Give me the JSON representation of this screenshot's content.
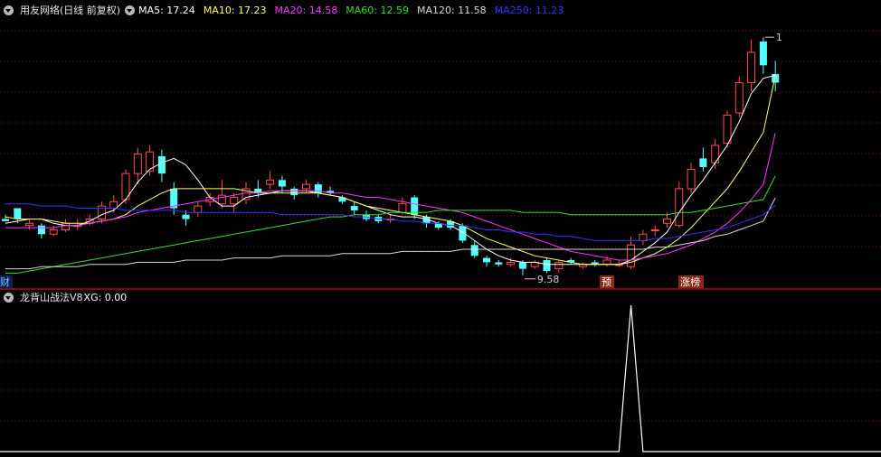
{
  "top_legend": {
    "title": "用友网络(日线 前复权)",
    "items": [
      {
        "label": "MA5: 17.24",
        "color": "#ffffff"
      },
      {
        "label": "MA10: 17.23",
        "color": "#ffff66"
      },
      {
        "label": "MA20: 14.58",
        "color": "#ff33ff"
      },
      {
        "label": "MA60: 12.59",
        "color": "#33dd33"
      },
      {
        "label": "MA120: 11.58",
        "color": "#d8d8d8"
      },
      {
        "label": "MA250: 11.23",
        "color": "#3333ff"
      }
    ]
  },
  "bottom_legend": {
    "title": "龙背山战法V8",
    "items": [
      {
        "label": "XG: 0.00",
        "color": "#ffffff"
      }
    ]
  },
  "markers": [
    {
      "label": "财",
      "index": 0,
      "bg": "#0b1f55",
      "fg": "#66ccff"
    },
    {
      "label": "预",
      "index": 50,
      "bg": "#8a2a1a",
      "fg": "#ffffff"
    },
    {
      "label": "涨榜",
      "index": 57,
      "bg": "#8a2a1a",
      "fg": "#ffffff"
    }
  ],
  "annotations": {
    "low_label": "9.58",
    "high_label": "1"
  },
  "colors": {
    "up": "#ff4c4c",
    "down": "#54ffff",
    "grid": "#7a1010",
    "separator": "#aa1414",
    "indicator": "#ffffff"
  },
  "chart_data": [
    {
      "type": "candlestick",
      "title": "用友网络(日线 前复权)",
      "ylim": [
        8.2,
        19.8
      ],
      "candles": [
        [
          10.6,
          10.5,
          10.8,
          10.6
        ],
        [
          11.1,
          10.6,
          10.8,
          10.4
        ],
        [
          10.3,
          10.4,
          10.6,
          10.1
        ],
        [
          10.3,
          9.9,
          10.4,
          9.7
        ],
        [
          9.9,
          10.1,
          10.3,
          9.8
        ],
        [
          10.1,
          10.4,
          10.6,
          10.0
        ],
        [
          10.3,
          10.3,
          10.6,
          10.1
        ],
        [
          10.4,
          10.6,
          10.8,
          10.3
        ],
        [
          10.6,
          11.2,
          11.4,
          10.4
        ],
        [
          11.1,
          11.4,
          11.7,
          10.9
        ],
        [
          11.5,
          12.7,
          12.9,
          11.3
        ],
        [
          12.7,
          13.6,
          13.9,
          12.2
        ],
        [
          12.8,
          13.7,
          14.0,
          12.6
        ],
        [
          13.5,
          12.7,
          13.8,
          12.3
        ],
        [
          12.0,
          11.1,
          12.3,
          10.8
        ],
        [
          10.8,
          10.6,
          11.0,
          10.3
        ],
        [
          10.9,
          11.2,
          11.4,
          10.7
        ],
        [
          11.4,
          11.6,
          11.8,
          11.2
        ],
        [
          11.3,
          11.7,
          12.4,
          11.1
        ],
        [
          11.3,
          11.6,
          11.8,
          10.9
        ],
        [
          11.5,
          12.0,
          12.3,
          11.3
        ],
        [
          12.0,
          11.8,
          12.4,
          11.6
        ],
        [
          12.2,
          12.4,
          12.8,
          12.0
        ],
        [
          12.4,
          12.1,
          12.6,
          11.8
        ],
        [
          12.0,
          11.7,
          12.1,
          11.5
        ],
        [
          12.0,
          12.2,
          12.4,
          11.8
        ],
        [
          12.2,
          11.8,
          12.3,
          11.6
        ],
        [
          11.9,
          11.8,
          12.1,
          11.7
        ],
        [
          11.6,
          11.4,
          11.7,
          11.3
        ],
        [
          11.2,
          11.0,
          11.4,
          10.8
        ],
        [
          10.8,
          10.6,
          11.0,
          10.5
        ],
        [
          10.7,
          10.5,
          10.8,
          10.4
        ],
        [
          10.6,
          10.6,
          10.8,
          10.4
        ],
        [
          10.9,
          11.3,
          11.6,
          10.8
        ],
        [
          11.6,
          10.8,
          11.7,
          10.6
        ],
        [
          10.7,
          10.4,
          10.8,
          10.2
        ],
        [
          10.4,
          10.2,
          10.5,
          10.1
        ],
        [
          10.5,
          10.2,
          10.6,
          10.1
        ],
        [
          10.3,
          9.6,
          10.4,
          9.5
        ],
        [
          9.4,
          8.9,
          9.6,
          8.8
        ],
        [
          8.8,
          8.6,
          8.9,
          8.4
        ],
        [
          8.6,
          8.5,
          8.7,
          8.4
        ],
        [
          8.5,
          8.6,
          8.8,
          8.4
        ],
        [
          8.6,
          8.3,
          8.7,
          8.0
        ],
        [
          8.4,
          8.6,
          8.7,
          8.3
        ],
        [
          8.7,
          8.2,
          8.8,
          8.1
        ],
        [
          8.3,
          8.6,
          8.7,
          8.1
        ],
        [
          8.7,
          8.6,
          8.8,
          8.5
        ],
        [
          8.4,
          8.5,
          8.6,
          8.3
        ],
        [
          8.6,
          8.5,
          8.7,
          8.4
        ],
        [
          8.5,
          8.7,
          8.9,
          8.4
        ],
        [
          8.5,
          8.5,
          8.7,
          8.4
        ],
        [
          8.4,
          9.4,
          9.8,
          8.3
        ],
        [
          9.6,
          9.9,
          10.1,
          9.4
        ],
        [
          10.1,
          10.1,
          10.3,
          9.8
        ],
        [
          10.4,
          10.6,
          10.9,
          10.2
        ],
        [
          10.3,
          12.0,
          12.3,
          10.2
        ],
        [
          12.0,
          12.9,
          13.2,
          11.8
        ],
        [
          13.4,
          13.0,
          13.9,
          12.8
        ],
        [
          13.2,
          14.0,
          14.3,
          12.9
        ],
        [
          14.1,
          15.4,
          15.6,
          13.9
        ],
        [
          15.5,
          16.9,
          17.2,
          15.3
        ],
        [
          16.9,
          18.3,
          18.9,
          16.5
        ],
        [
          18.8,
          17.7,
          19.0,
          17.3
        ],
        [
          17.3,
          16.9,
          17.9,
          16.5
        ]
      ],
      "series": [
        {
          "name": "MA5",
          "color": "#ffffff",
          "values": [
            10.4,
            10.5,
            10.6,
            10.6,
            10.4,
            10.3,
            10.3,
            10.5,
            10.8,
            11.0,
            11.5,
            12.3,
            12.9,
            13.2,
            13.4,
            13.1,
            12.4,
            11.6,
            11.2,
            11.2,
            11.6,
            11.7,
            11.8,
            11.9,
            11.9,
            11.9,
            11.8,
            11.7,
            11.6,
            11.4,
            11.2,
            11.0,
            10.8,
            10.7,
            10.7,
            10.6,
            10.4,
            10.3,
            10.0,
            9.6,
            9.2,
            8.9,
            8.7,
            8.6,
            8.6,
            8.5,
            8.5,
            8.5,
            8.5,
            8.5,
            8.5,
            8.5,
            8.7,
            9.1,
            9.5,
            10.0,
            10.9,
            11.7,
            12.4,
            13.2,
            14.0,
            15.1,
            16.4,
            17.1,
            17.24
          ]
        },
        {
          "name": "MA10",
          "color": "#ffff66",
          "values": [
            10.7,
            10.6,
            10.6,
            10.6,
            10.5,
            10.4,
            10.4,
            10.4,
            10.5,
            10.6,
            10.8,
            11.2,
            11.5,
            11.8,
            12.0,
            12.0,
            12.0,
            12.0,
            12.0,
            12.0,
            11.9,
            11.8,
            11.8,
            11.8,
            11.8,
            11.8,
            11.8,
            11.7,
            11.6,
            11.4,
            11.2,
            11.1,
            11.0,
            10.9,
            10.8,
            10.7,
            10.6,
            10.5,
            10.3,
            10.0,
            9.7,
            9.5,
            9.3,
            9.1,
            8.9,
            8.8,
            8.7,
            8.6,
            8.5,
            8.5,
            8.5,
            8.5,
            8.6,
            8.8,
            9.0,
            9.3,
            9.7,
            10.2,
            10.8,
            11.4,
            12.0,
            12.8,
            13.7,
            14.6,
            17.23
          ]
        },
        {
          "name": "MA20",
          "color": "#ff33ff",
          "values": [
            10.2,
            10.2,
            10.2,
            10.2,
            10.2,
            10.3,
            10.3,
            10.4,
            10.5,
            10.6,
            10.7,
            10.9,
            11.0,
            11.1,
            11.2,
            11.3,
            11.4,
            11.5,
            11.6,
            11.7,
            11.8,
            11.8,
            11.9,
            11.9,
            11.9,
            11.9,
            11.9,
            11.8,
            11.8,
            11.7,
            11.6,
            11.6,
            11.5,
            11.4,
            11.3,
            11.2,
            11.1,
            11.0,
            10.9,
            10.7,
            10.5,
            10.3,
            10.1,
            9.9,
            9.7,
            9.5,
            9.3,
            9.1,
            9.0,
            8.9,
            8.8,
            8.7,
            8.7,
            8.8,
            8.9,
            9.0,
            9.2,
            9.4,
            9.7,
            10.0,
            10.4,
            10.9,
            11.5,
            12.2,
            14.58
          ]
        },
        {
          "name": "MA60",
          "color": "#33dd33",
          "values": [
            8.1,
            8.1,
            8.2,
            8.3,
            8.4,
            8.5,
            8.6,
            8.7,
            8.8,
            8.9,
            9.0,
            9.1,
            9.2,
            9.3,
            9.4,
            9.5,
            9.6,
            9.7,
            9.8,
            9.9,
            10.0,
            10.1,
            10.2,
            10.3,
            10.4,
            10.5,
            10.6,
            10.7,
            10.7,
            10.8,
            10.8,
            10.8,
            10.9,
            10.9,
            10.9,
            10.9,
            11.0,
            11.0,
            11.0,
            11.0,
            11.0,
            11.0,
            11.0,
            10.9,
            10.9,
            10.9,
            10.9,
            10.8,
            10.8,
            10.8,
            10.8,
            10.8,
            10.8,
            10.8,
            10.8,
            10.8,
            10.9,
            10.9,
            11.0,
            11.1,
            11.2,
            11.3,
            11.4,
            11.5,
            12.59
          ]
        },
        {
          "name": "MA120",
          "color": "#d8d8d8",
          "values": [
            8.3,
            8.3,
            8.3,
            8.4,
            8.4,
            8.4,
            8.4,
            8.5,
            8.5,
            8.5,
            8.5,
            8.6,
            8.6,
            8.6,
            8.6,
            8.7,
            8.7,
            8.7,
            8.7,
            8.8,
            8.8,
            8.8,
            8.8,
            8.9,
            8.9,
            8.9,
            8.9,
            8.9,
            9.0,
            9.0,
            9.0,
            9.0,
            9.0,
            9.1,
            9.1,
            9.1,
            9.1,
            9.1,
            9.2,
            9.2,
            9.2,
            9.2,
            9.2,
            9.2,
            9.2,
            9.2,
            9.2,
            9.2,
            9.2,
            9.2,
            9.2,
            9.2,
            9.2,
            9.2,
            9.3,
            9.3,
            9.4,
            9.5,
            9.6,
            9.8,
            9.9,
            10.1,
            10.3,
            10.5,
            11.58
          ]
        },
        {
          "name": "MA250",
          "color": "#3333ff",
          "values": [
            11.3,
            11.3,
            11.3,
            11.2,
            11.2,
            11.2,
            11.1,
            11.1,
            11.1,
            11.1,
            11.0,
            11.0,
            11.0,
            11.0,
            11.0,
            10.9,
            10.9,
            10.9,
            10.9,
            10.9,
            10.9,
            10.9,
            10.9,
            10.8,
            10.8,
            10.8,
            10.8,
            10.8,
            10.8,
            10.7,
            10.7,
            10.6,
            10.6,
            10.5,
            10.5,
            10.4,
            10.4,
            10.3,
            10.3,
            10.2,
            10.1,
            10.1,
            10.0,
            10.0,
            9.9,
            9.9,
            9.8,
            9.8,
            9.7,
            9.6,
            9.6,
            9.6,
            9.6,
            9.6,
            9.7,
            9.7,
            9.8,
            9.9,
            10.0,
            10.1,
            10.2,
            10.4,
            10.6,
            10.8,
            11.23
          ]
        }
      ]
    },
    {
      "type": "line",
      "title": "龙背山战法V8",
      "ylim": [
        0,
        1
      ],
      "series": [
        {
          "name": "XG",
          "color": "#ffffff",
          "values": [
            0,
            0,
            0,
            0,
            0,
            0,
            0,
            0,
            0,
            0,
            0,
            0,
            0,
            0,
            0,
            0,
            0,
            0,
            0,
            0,
            0,
            0,
            0,
            0,
            0,
            0,
            0,
            0,
            0,
            0,
            0,
            0,
            0,
            0,
            0,
            0,
            0,
            0,
            0,
            0,
            0,
            0,
            0,
            0,
            0,
            0,
            0,
            0,
            0,
            0,
            0,
            0,
            1,
            0,
            0,
            0,
            0,
            0,
            0,
            0,
            0,
            0,
            0,
            0,
            0
          ]
        }
      ]
    }
  ]
}
